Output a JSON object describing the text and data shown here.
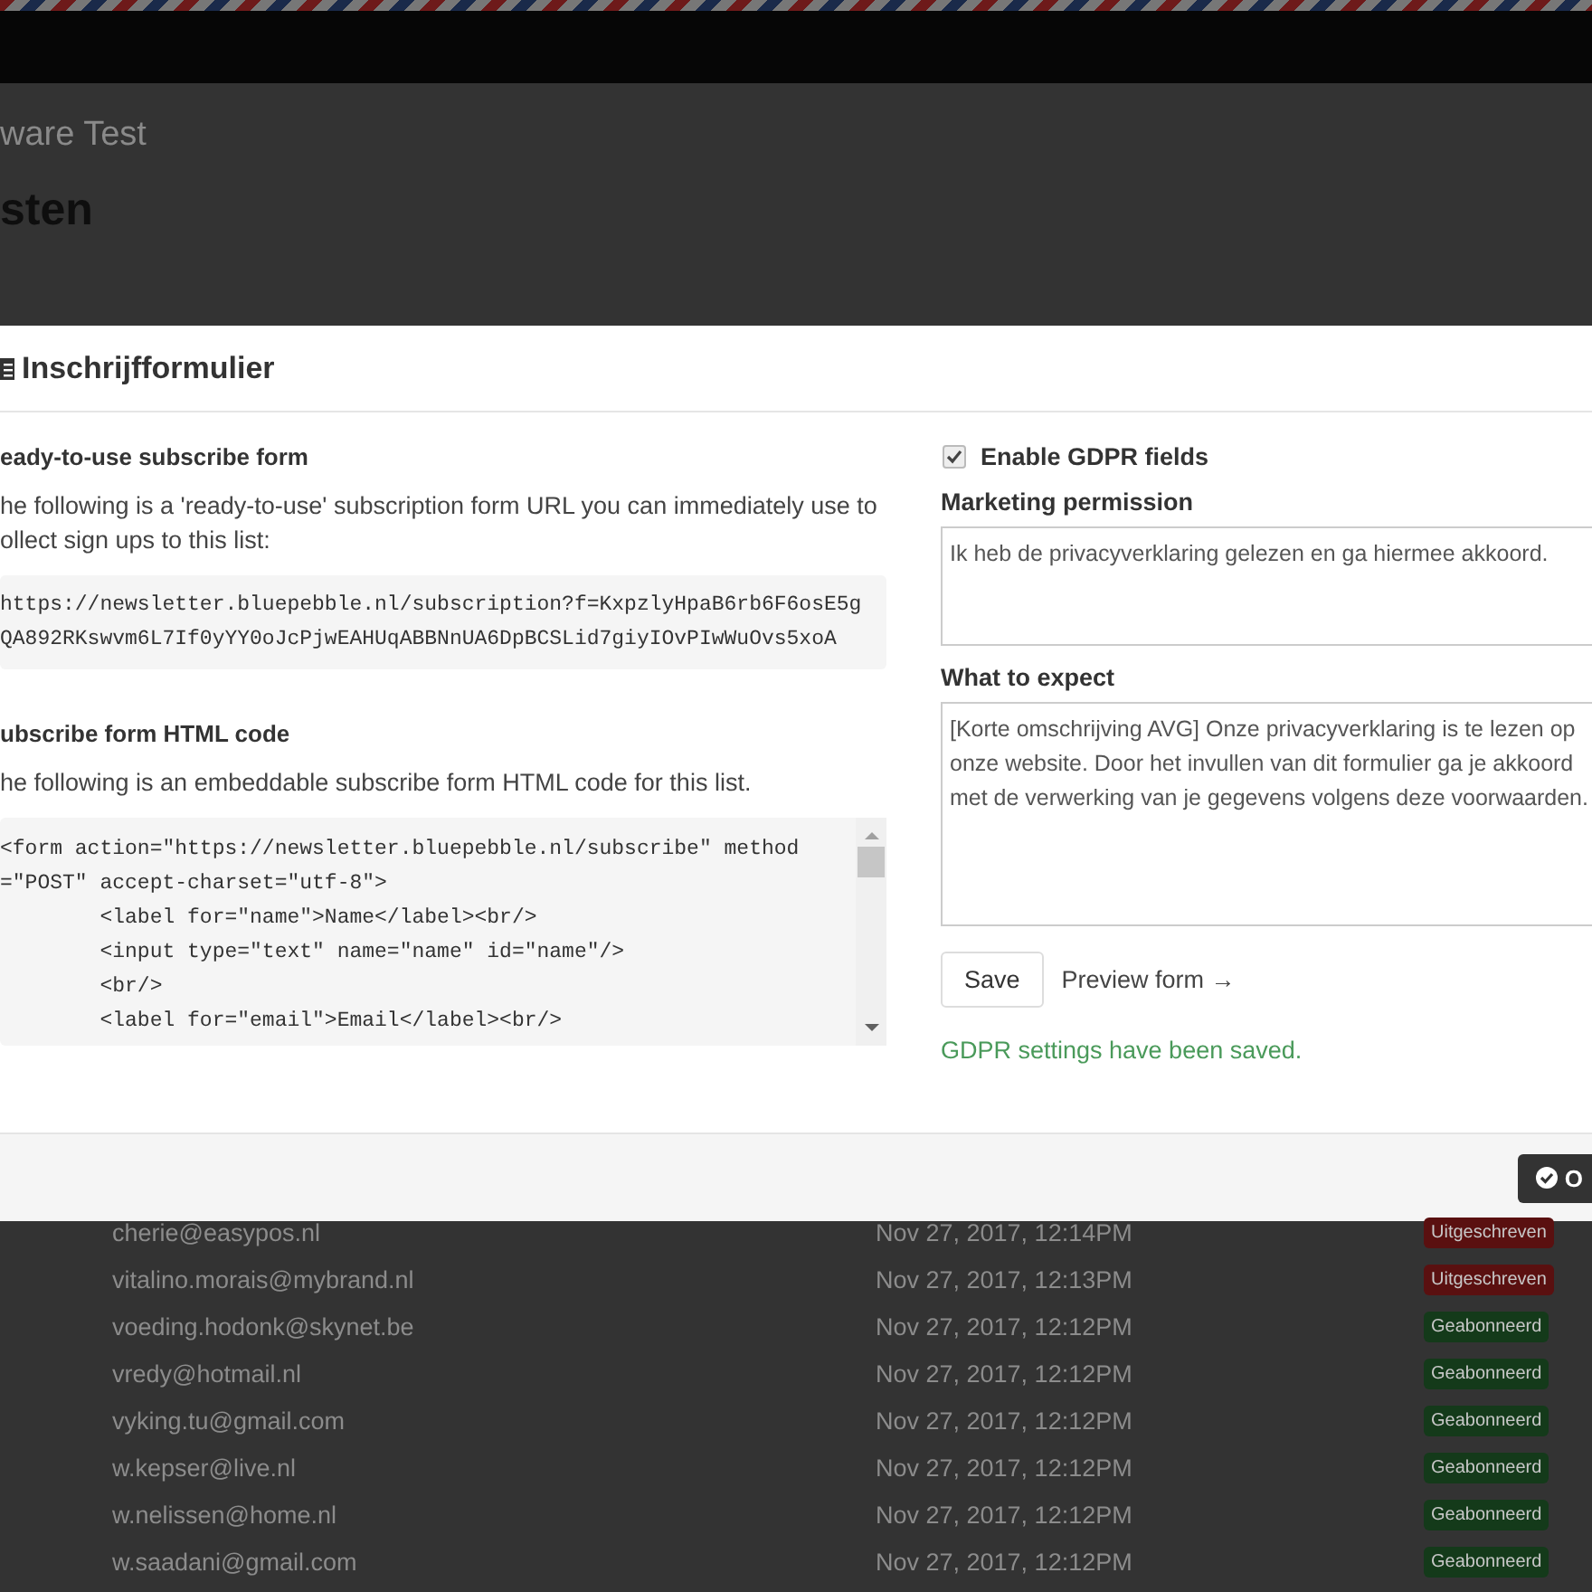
{
  "app_title": "ware Test",
  "page_title": "sten",
  "modal": {
    "title": "Inschrijfformulier",
    "sections": [
      {
        "kind": "url",
        "heading": "eady-to-use subscribe form",
        "lines": [
          "he following is a 'ready-to-use' subscription form URL you can immediately use to",
          "ollect sign ups to this list:"
        ],
        "code_lines": [
          "https://newsletter.bluepebble.nl/subscription?f=KxpzlyHpaB6rb6F6osE5g",
          "QA892RKswvm6L7If0yYY0oJcPjwEAHUqABBNnUA6DpBCSLid7giyIOvPIwWuOvs5xoA"
        ]
      },
      {
        "kind": "code",
        "heading": "ubscribe form HTML code",
        "lines": [
          "he following is an embeddable subscribe form HTML code for this list."
        ],
        "code_lines": [
          "<form action=\"https://newsletter.bluepebble.nl/subscribe\" method",
          "=\"POST\" accept-charset=\"utf-8\">",
          "        <label for=\"name\">Name</label><br/>",
          "        <input type=\"text\" name=\"name\" id=\"name\"/>",
          "        <br/>",
          "        <label for=\"email\">Email</label><br/>"
        ]
      }
    ],
    "gdpr_checkbox": {
      "label": "Enable GDPR fields",
      "checked": true
    },
    "fields": [
      {
        "label": "Marketing permission",
        "value": "Ik heb de privacyverklaring gelezen en ga hiermee akkoord."
      },
      {
        "label": "What to expect",
        "value": "[Korte omschrijving AVG] Onze privacyverklaring is te lezen op onze website. Door het invullen van dit formulier ga je akkoord met de verwerking van je gegevens volgens deze voorwaarden."
      }
    ],
    "save_button": "Save",
    "preview_link": "Preview form →",
    "status_message": "GDPR settings have been saved.",
    "ok_button": "O"
  },
  "subscribers": [
    {
      "email": "cherie@easypos.nl",
      "date": "Nov 27, 2017, 12:14PM",
      "status": "Uitgeschreven",
      "color": "#5a1010"
    },
    {
      "email": "vitalino.morais@mybrand.nl",
      "date": "Nov 27, 2017, 12:13PM",
      "status": "Uitgeschreven",
      "color": "#5a1010"
    },
    {
      "email": "voeding.hodonk@skynet.be",
      "date": "Nov 27, 2017, 12:12PM",
      "status": "Geabonneerd",
      "color": "#143a1a"
    },
    {
      "email": "vredy@hotmail.nl",
      "date": "Nov 27, 2017, 12:12PM",
      "status": "Geabonneerd",
      "color": "#143a1a"
    },
    {
      "email": "vyking.tu@gmail.com",
      "date": "Nov 27, 2017, 12:12PM",
      "status": "Geabonneerd",
      "color": "#143a1a"
    },
    {
      "email": "w.kepser@live.nl",
      "date": "Nov 27, 2017, 12:12PM",
      "status": "Geabonneerd",
      "color": "#143a1a"
    },
    {
      "email": "w.nelissen@home.nl",
      "date": "Nov 27, 2017, 12:12PM",
      "status": "Geabonneerd",
      "color": "#143a1a"
    },
    {
      "email": "w.saadani@gmail.com",
      "date": "Nov 27, 2017, 12:12PM",
      "status": "Geabonneerd",
      "color": "#143a1a"
    }
  ]
}
